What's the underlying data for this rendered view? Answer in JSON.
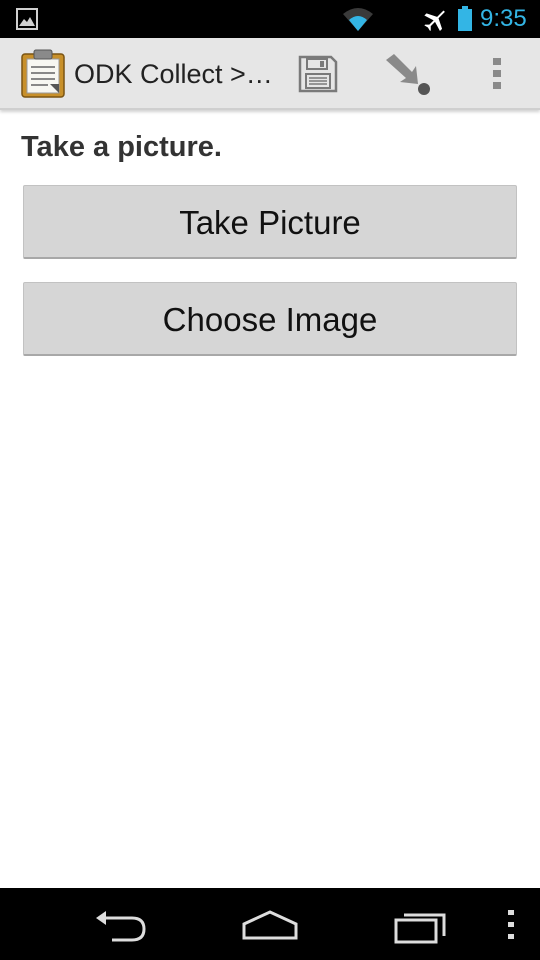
{
  "status_bar": {
    "time": "9:35",
    "time_color": "#33b5e5",
    "icons": [
      "gallery-icon",
      "wifi-icon",
      "airplane-mode-icon",
      "battery-icon"
    ]
  },
  "action_bar": {
    "title": "ODK Collect >…",
    "icons": [
      "odk-clipboard-icon",
      "save-icon",
      "jump-to-icon",
      "overflow-menu-icon"
    ]
  },
  "question": {
    "label": "Take a picture."
  },
  "buttons": {
    "take_picture": "Take Picture",
    "choose_image": "Choose Image"
  },
  "nav_bar": {
    "icons": [
      "back-icon",
      "home-icon",
      "recents-icon",
      "menu-icon"
    ]
  }
}
